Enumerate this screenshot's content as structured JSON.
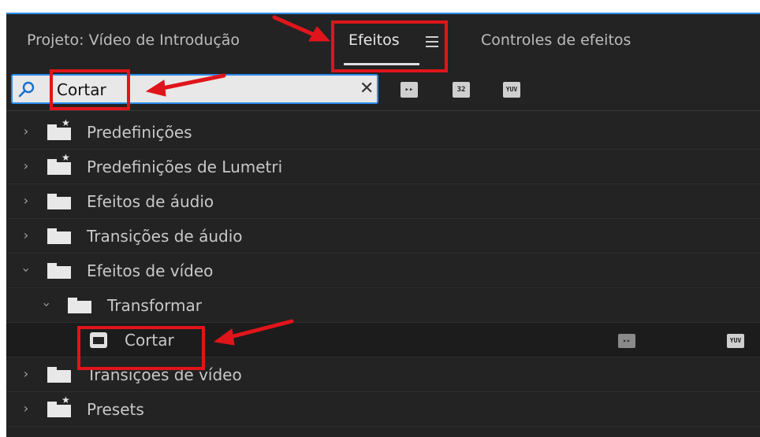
{
  "panel_tabs": [
    {
      "label": "Projeto: Vídeo de Introdução"
    },
    {
      "label": "Efeitos"
    },
    {
      "label": "Controles de efeitos"
    }
  ],
  "search": {
    "value": "Cortar",
    "clear_glyph": "✕"
  },
  "toolbar_icons": [
    {
      "name": "accelerated-effects-icon",
      "text": "▸▸"
    },
    {
      "name": "32bit-color-icon",
      "text": "32"
    },
    {
      "name": "yuv-effects-icon",
      "text": "YUV"
    }
  ],
  "tree": [
    {
      "label": "Predefinições",
      "expanded": false,
      "icon": "preset-folder-icon"
    },
    {
      "label": "Predefinições de Lumetri",
      "expanded": false,
      "icon": "preset-folder-icon"
    },
    {
      "label": "Efeitos de áudio",
      "expanded": false,
      "icon": "folder-icon"
    },
    {
      "label": "Transições de áudio",
      "expanded": false,
      "icon": "folder-icon"
    },
    {
      "label": "Efeitos de vídeo",
      "expanded": true,
      "icon": "folder-icon"
    },
    {
      "label": "Transformar",
      "expanded": true,
      "icon": "folder-icon"
    },
    {
      "label": "Cortar",
      "icon": "effect-icon",
      "badges": [
        "▸▸",
        "YUV"
      ]
    },
    {
      "label": "Transições de vídeo",
      "expanded": false,
      "icon": "folder-icon"
    },
    {
      "label": "Presets",
      "expanded": false,
      "icon": "preset-folder-icon"
    }
  ],
  "colors": {
    "accent": "#2d8ceb",
    "annotation": "#e0151b",
    "panel_bg": "#232323"
  }
}
